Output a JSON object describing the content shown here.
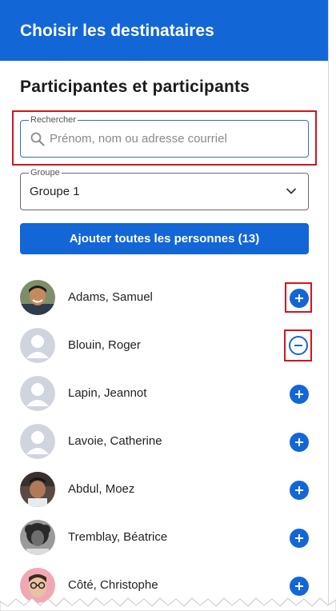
{
  "header": {
    "title": "Choisir les destinataires"
  },
  "section": {
    "title": "Participantes et participants"
  },
  "search": {
    "label": "Rechercher",
    "placeholder": "Prénom, nom ou adresse courriel",
    "icon": "search-icon"
  },
  "group_select": {
    "label": "Groupe",
    "value": "Groupe 1",
    "icon": "chevron-down-icon"
  },
  "add_all_button": {
    "label": "Ajouter toutes les personnes (13)"
  },
  "colors": {
    "primary": "#1366d6",
    "highlight": "#d2151f",
    "placeholder_avatar": "#d0d5dd"
  },
  "participants": [
    {
      "name": "Adams, Samuel",
      "avatar": "photo",
      "action": "add"
    },
    {
      "name": "Blouin, Roger",
      "avatar": "placeholder",
      "action": "remove"
    },
    {
      "name": "Lapin, Jeannot",
      "avatar": "placeholder",
      "action": "add"
    },
    {
      "name": "Lavoie, Catherine",
      "avatar": "placeholder",
      "action": "add"
    },
    {
      "name": "Abdul, Moez",
      "avatar": "photo",
      "action": "add"
    },
    {
      "name": "Tremblay, Béatrice",
      "avatar": "photo",
      "action": "add"
    },
    {
      "name": "Côté, Christophe",
      "avatar": "photo",
      "action": "add"
    }
  ]
}
